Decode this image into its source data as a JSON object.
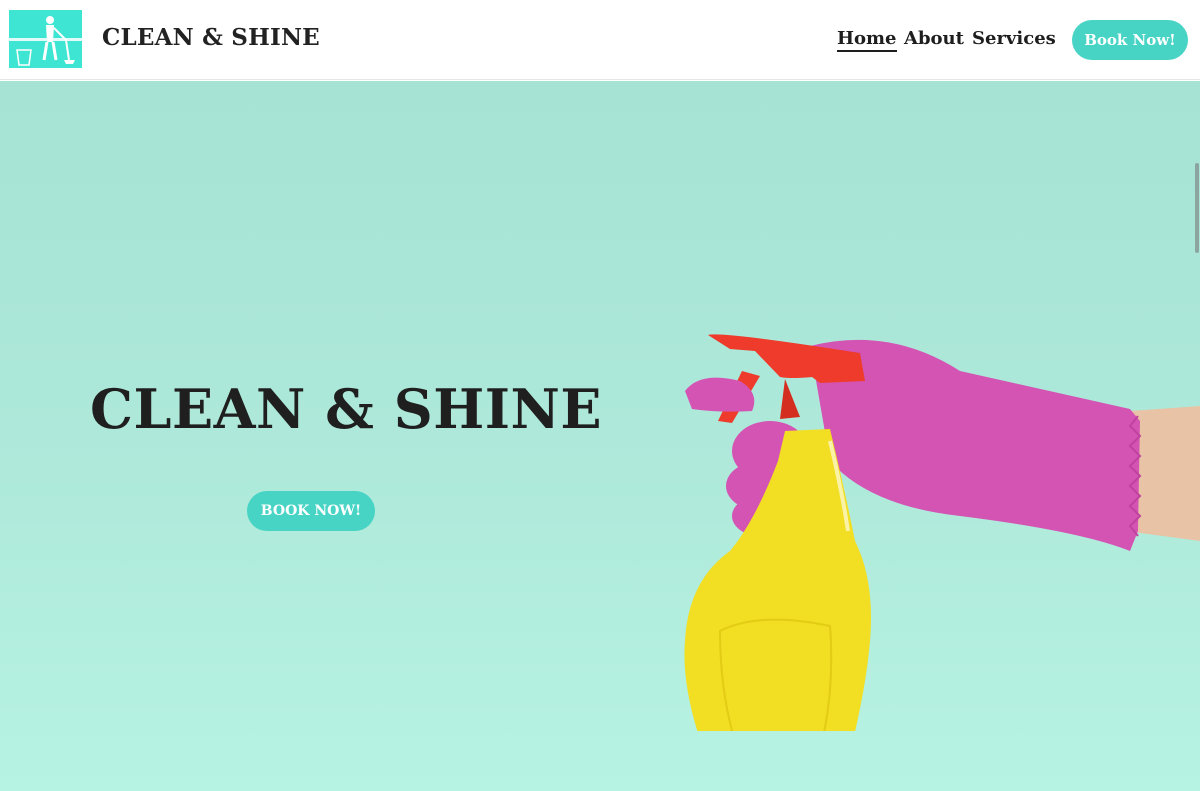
{
  "header": {
    "brand": "CLEAN & SHINE",
    "logo_icon": "cleaning-person-logo",
    "nav": [
      {
        "label": "Home",
        "active": true
      },
      {
        "label": "About",
        "active": false
      },
      {
        "label": "Services",
        "active": false
      }
    ],
    "book_label": "Book Now!"
  },
  "hero": {
    "title": "CLEAN & SHINE",
    "book_label": "BOOK NOW!",
    "image_icon": "spray-bottle-glove-image"
  },
  "colors": {
    "accent": "#47d4c5",
    "logo_bg": "#3ee5d3",
    "hero_bg": "#aee9da",
    "text": "#1f1f1f",
    "glove": "#d454b4",
    "bottle": "#f2de22",
    "trigger": "#ee3b2c",
    "skin": "#e8c3a6"
  }
}
